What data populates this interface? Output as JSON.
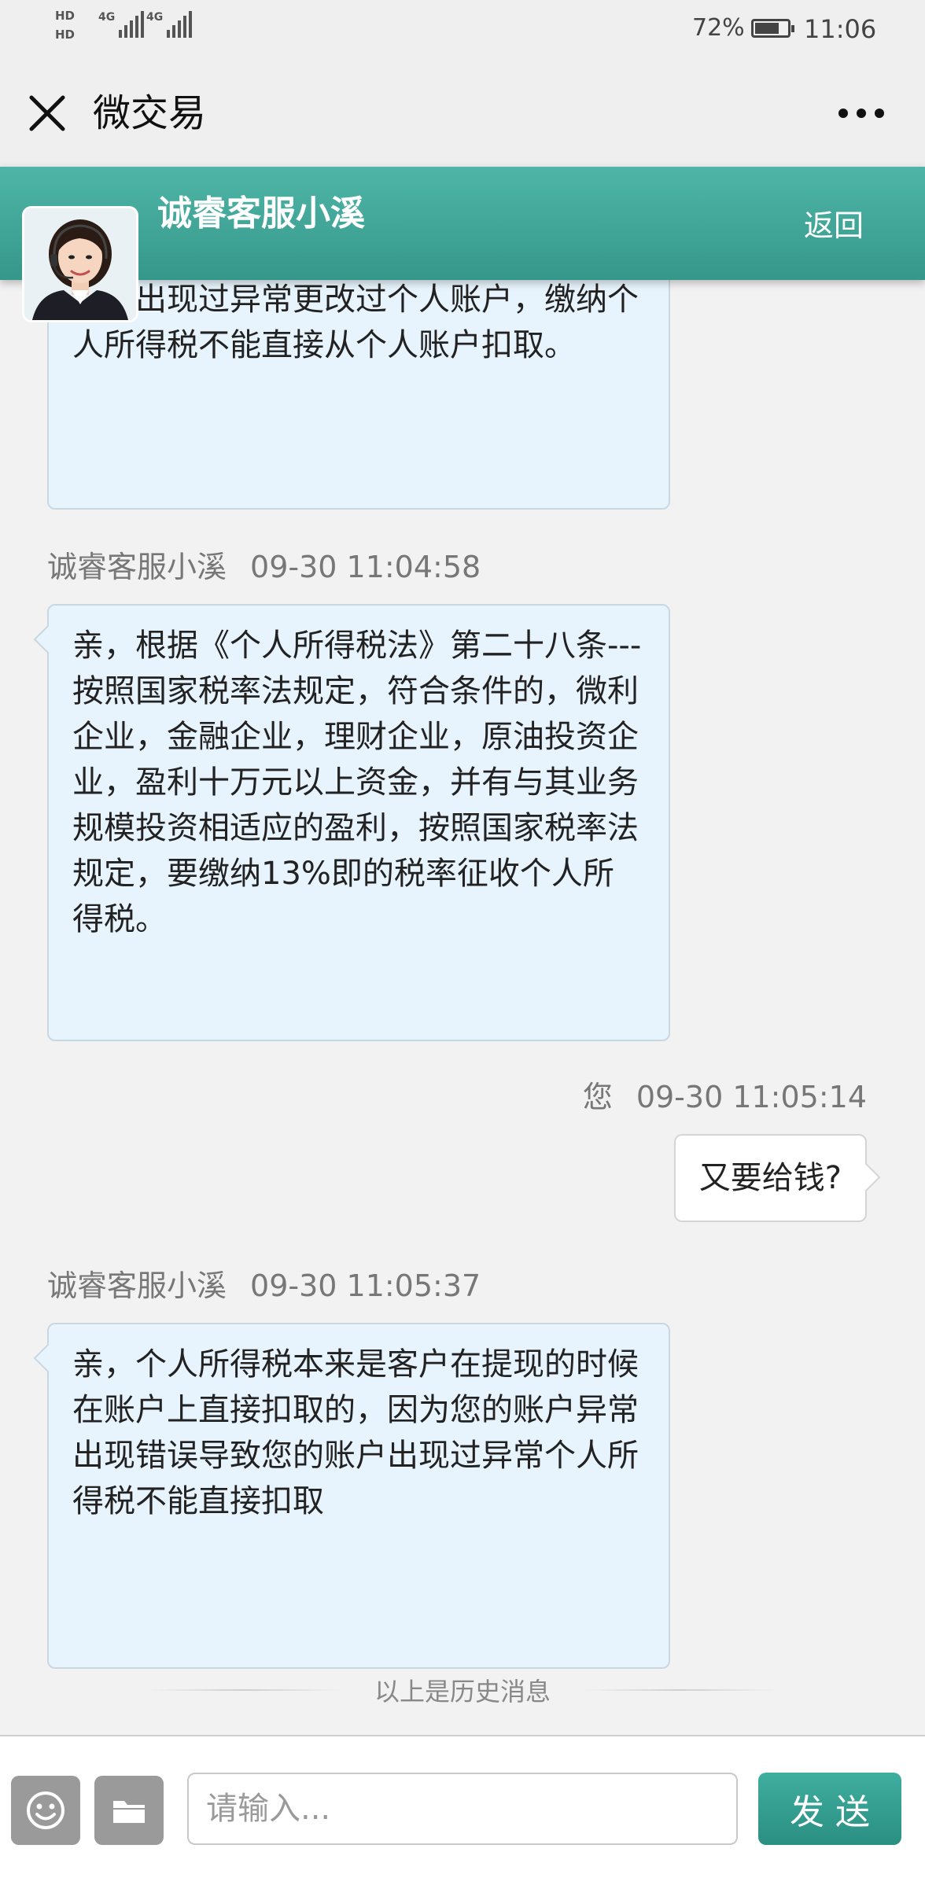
{
  "status_bar": {
    "hd1": "HD",
    "hd2": "HD",
    "net1": "4G",
    "net2": "4G",
    "battery_pct": "72%",
    "time": "11:06"
  },
  "app_bar": {
    "title": "微交易"
  },
  "chat": {
    "agent_name": "诚睿客服小溪",
    "back_label": "返回",
    "messages": [
      {
        "sender": "诚睿客服小溪",
        "time": "",
        "text": "账户出现过异常更改过个人账户，缴纳个人所得税不能直接从个人账户扣取。"
      },
      {
        "sender": "诚睿客服小溪",
        "time": "09-30 11:04:58",
        "text": "亲，根据《个人所得税法》第二十八条---按照国家税率法规定，符合条件的，微利企业，金融企业，理财企业，原油投资企业，盈利十万元以上资金，并有与其业务规模投资相适应的盈利，按照国家税率法规定，要缴纳13%即的税率征收个人所得税。"
      },
      {
        "sender": "您",
        "time": "09-30 11:05:14",
        "text": "又要给钱?"
      },
      {
        "sender": "诚睿客服小溪",
        "time": "09-30 11:05:37",
        "text": "亲，个人所得税本来是客户在提现的时候在账户上直接扣取的，因为您的账户异常出现错误导致您的账户出现过异常个人所得税不能直接扣取"
      }
    ],
    "history_note": "以上是历史消息"
  },
  "input_bar": {
    "placeholder": "请输入...",
    "send_label": "发送"
  },
  "colors": {
    "header_teal": "#3aa596",
    "bubble_in": "#e8f4fd",
    "bubble_out": "#ffffff",
    "send_button": "#2f9687"
  },
  "icons": [
    "close-icon",
    "more-icon",
    "emoji-icon",
    "folder-icon",
    "agent-avatar"
  ]
}
